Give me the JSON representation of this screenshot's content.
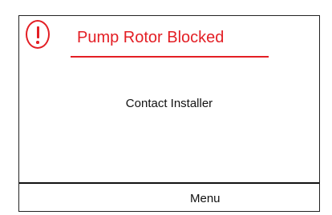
{
  "alert": {
    "icon": "exclamation-circle-icon",
    "title": "Pump Rotor Blocked",
    "message": "Contact Installer"
  },
  "footer": {
    "menu_label": "Menu"
  },
  "colors": {
    "alert": "#e31e24",
    "text": "#111111",
    "border": "#222222",
    "background": "#ffffff"
  }
}
